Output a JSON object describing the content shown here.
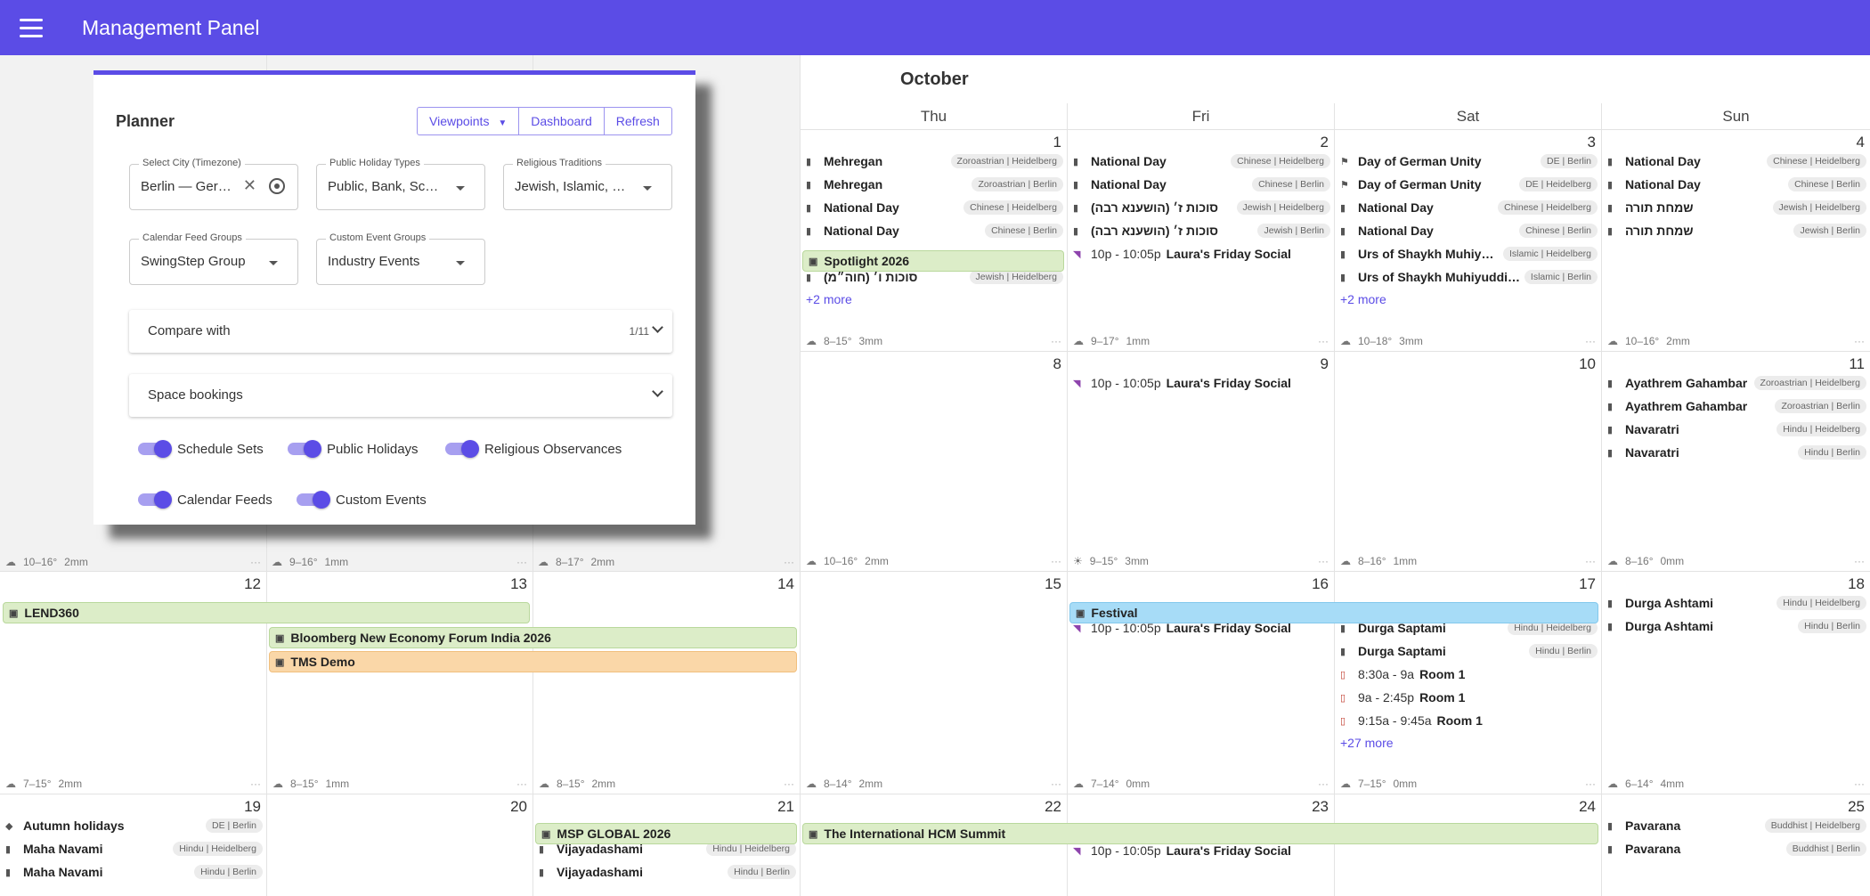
{
  "appbar": {
    "title": "Management Panel"
  },
  "calendar": {
    "month": "October",
    "weekdays": [
      "Thu",
      "Fri",
      "Sat",
      "Sun"
    ],
    "days": {
      "d1": "1",
      "d2": "2",
      "d3": "3",
      "d4": "4",
      "d8": "8",
      "d9": "9",
      "d10": "10",
      "d11": "11",
      "d12": "12",
      "d13": "13",
      "d14": "14",
      "d15": "15",
      "d16": "16",
      "d17": "17",
      "d18": "18",
      "d19": "19",
      "d20": "20",
      "d21": "21",
      "d22": "22",
      "d23": "23",
      "d24": "24",
      "d25": "25"
    },
    "events": {
      "oct1": [
        {
          "title": "Mehregan",
          "tag": "Zoroastrian | Heidelberg"
        },
        {
          "title": "Mehregan",
          "tag": "Zoroastrian | Berlin"
        },
        {
          "title": "National Day",
          "tag": "Chinese | Heidelberg"
        },
        {
          "title": "National Day",
          "tag": "Chinese | Berlin"
        },
        {
          "title": "סוכות ו׳ (חוה״מ)",
          "tag": "Jewish | Heidelberg"
        }
      ],
      "oct1_more": "+2 more",
      "spotlight": "Spotlight 2026",
      "oct2": [
        {
          "title": "National Day",
          "tag": "Chinese | Heidelberg"
        },
        {
          "title": "National Day",
          "tag": "Chinese | Berlin"
        },
        {
          "title": "סוכות ז׳ (הושענא רבה)",
          "tag": "Jewish | Heidelberg"
        },
        {
          "title": "סוכות ז׳ (הושענא רבה)",
          "tag": "Jewish | Berlin"
        }
      ],
      "social_time": "10p - 10:05p",
      "social_title": "Laura's Friday Social",
      "oct3": [
        {
          "title": "Day of German Unity",
          "tag": "DE | Berlin"
        },
        {
          "title": "Day of German Unity",
          "tag": "DE | Heidelberg"
        },
        {
          "title": "National Day",
          "tag": "Chinese | Heidelberg"
        },
        {
          "title": "National Day",
          "tag": "Chinese | Berlin"
        },
        {
          "title": "Urs of Shaykh Muhiyuddin Ibn Arabi",
          "tag": "Islamic | Heidelberg"
        },
        {
          "title": "Urs of Shaykh Muhiyuddin Ibn Arabi",
          "tag": "Islamic | Berlin"
        }
      ],
      "oct3_more": "+2 more",
      "oct4": [
        {
          "title": "National Day",
          "tag": "Chinese | Heidelberg"
        },
        {
          "title": "National Day",
          "tag": "Chinese | Berlin"
        },
        {
          "title": "שמחת תורה",
          "tag": "Jewish | Heidelberg"
        },
        {
          "title": "שמחת תורה",
          "tag": "Jewish | Berlin"
        }
      ],
      "oct11": [
        {
          "title": "Ayathrem Gahambar",
          "tag": "Zoroastrian | Heidelberg"
        },
        {
          "title": "Ayathrem Gahambar",
          "tag": "Zoroastrian | Berlin"
        },
        {
          "title": "Navaratri",
          "tag": "Hindu | Heidelberg"
        },
        {
          "title": "Navaratri",
          "tag": "Hindu | Berlin"
        }
      ],
      "lend360": "LEND360",
      "bloomberg": "Bloomberg New Economy Forum India 2026",
      "tms": "TMS Demo",
      "festival": "Festival",
      "oct17": [
        {
          "title": "Durga Saptami",
          "tag": "Hindu | Heidelberg"
        },
        {
          "title": "Durga Saptami",
          "tag": "Hindu | Berlin"
        }
      ],
      "oct17_rooms": [
        {
          "time": "8:30a - 9a",
          "title": "Room 1"
        },
        {
          "time": "9a - 2:45p",
          "title": "Room 1"
        },
        {
          "time": "9:15a - 9:45a",
          "title": "Room 1"
        }
      ],
      "oct17_more": "+27 more",
      "oct18": [
        {
          "title": "Durga Ashtami",
          "tag": "Hindu | Heidelberg"
        },
        {
          "title": "Durga Ashtami",
          "tag": "Hindu | Berlin"
        }
      ],
      "oct19": [
        {
          "title": "Autumn holidays",
          "tag": "DE | Berlin"
        },
        {
          "title": "Maha Navami",
          "tag": "Hindu | Heidelberg"
        },
        {
          "title": "Maha Navami",
          "tag": "Hindu | Berlin"
        }
      ],
      "msp": "MSP GLOBAL 2026",
      "oct21": [
        {
          "title": "Vijayadashami",
          "tag": "Hindu | Heidelberg"
        },
        {
          "title": "Vijayadashami",
          "tag": "Hindu | Berlin"
        }
      ],
      "hcm": "The International HCM Summit",
      "oct25": [
        {
          "title": "Pavarana",
          "tag": "Buddhist | Heidelberg"
        },
        {
          "title": "Pavarana",
          "tag": "Buddhist | Berlin"
        }
      ]
    },
    "weather": {
      "w1": {
        "temp": "8–15°",
        "rain": "3mm"
      },
      "w2": {
        "temp": "9–17°",
        "rain": "1mm"
      },
      "w3": {
        "temp": "10–18°",
        "rain": "3mm"
      },
      "w4": {
        "temp": "10–16°",
        "rain": "2mm"
      },
      "w5": {
        "temp": "10–16°",
        "rain": "2mm"
      },
      "w6": {
        "temp": "9–16°",
        "rain": "1mm"
      },
      "w7": {
        "temp": "8–17°",
        "rain": "2mm"
      },
      "w8": {
        "temp": "10–16°",
        "rain": "2mm"
      },
      "w9": {
        "temp": "9–15°",
        "rain": "3mm"
      },
      "w10": {
        "temp": "8–16°",
        "rain": "1mm"
      },
      "w11": {
        "temp": "8–16°",
        "rain": "0mm"
      },
      "w12": {
        "temp": "7–15°",
        "rain": "2mm"
      },
      "w13": {
        "temp": "8–15°",
        "rain": "1mm"
      },
      "w14": {
        "temp": "8–15°",
        "rain": "2mm"
      },
      "w15": {
        "temp": "8–14°",
        "rain": "2mm"
      },
      "w16": {
        "temp": "7–14°",
        "rain": "0mm"
      },
      "w17": {
        "temp": "7–15°",
        "rain": "0mm"
      },
      "w18": {
        "temp": "6–14°",
        "rain": "4mm"
      }
    }
  },
  "planner": {
    "title": "Planner",
    "buttons": {
      "viewpoints": "Viewpoints",
      "dashboard": "Dashboard",
      "refresh": "Refresh"
    },
    "fields": {
      "city": {
        "label": "Select City (Timezone)",
        "value": "Berlin — Germany"
      },
      "holiday": {
        "label": "Public Holiday Types",
        "value": "Public, Bank, School, Optional"
      },
      "religious": {
        "label": "Religious Traditions",
        "value": "Jewish, Islamic, Hindu"
      },
      "feeds": {
        "label": "Calendar Feed Groups",
        "value": "SwingStep Group"
      },
      "custom": {
        "label": "Custom Event Groups",
        "value": "Industry Events"
      }
    },
    "compare": {
      "label": "Compare with",
      "count": "1/11"
    },
    "space": {
      "label": "Space bookings"
    },
    "toggles": {
      "schedule": "Schedule Sets",
      "holidays": "Public Holidays",
      "religious": "Religious Observances",
      "feeds": "Calendar Feeds",
      "custom": "Custom Events"
    }
  }
}
